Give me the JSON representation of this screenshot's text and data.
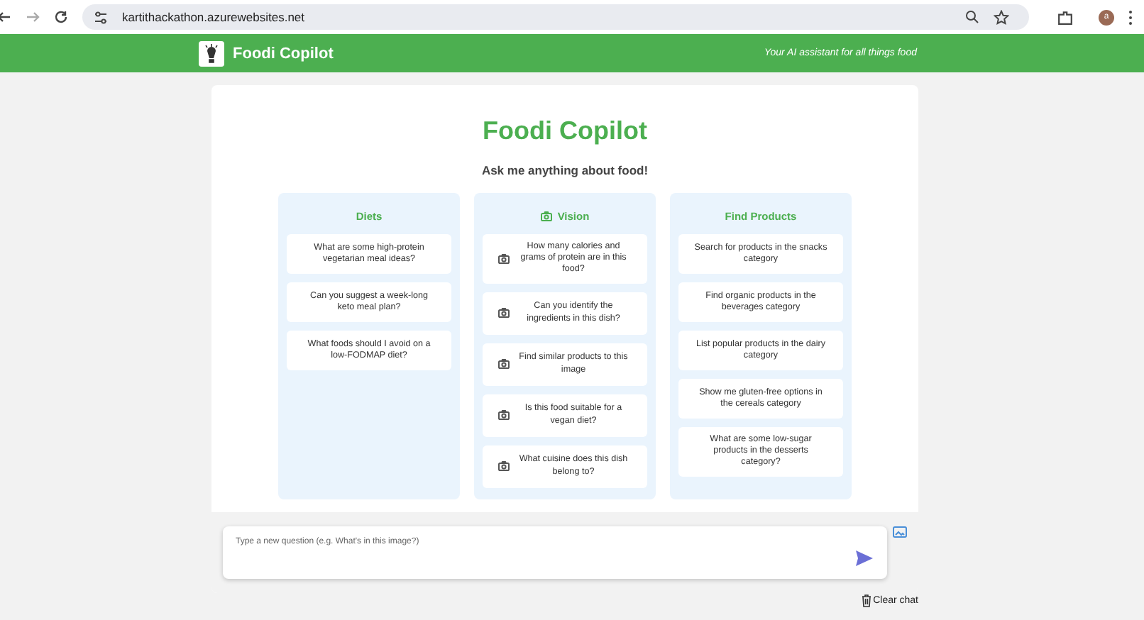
{
  "browser": {
    "url": "kartithackathon.azurewebsites.net",
    "avatar": "a"
  },
  "header": {
    "title": "Foodi Copilot",
    "tagline": "Your AI assistant for all things food"
  },
  "main": {
    "title": "Foodi Copilot",
    "subtitle": "Ask me anything about food!"
  },
  "columns": [
    {
      "title": "Diets",
      "kind": "text",
      "prompts": [
        "What are some high-protein vegetarian meal ideas?",
        "Can you suggest a week-long keto meal plan?",
        "What foods should I avoid on a low-FODMAP diet?"
      ]
    },
    {
      "title": "Vision",
      "kind": "image",
      "prompts": [
        "How many calories and grams of protein are in this food?",
        "Can you identify the ingredients in this dish?",
        "Find similar products to this image",
        "Is this food suitable for a vegan diet?",
        "What cuisine does this dish belong to?"
      ]
    },
    {
      "title": "Find Products",
      "kind": "text",
      "prompts": [
        "Search for products in the snacks category",
        "Find organic products in the beverages category",
        "List popular products in the dairy category",
        "Show me gluten-free options in the cereals category",
        "What are some low-sugar products in the desserts category?"
      ]
    }
  ],
  "chat_input": {
    "placeholder": "Type a new question (e.g. What's in this image?)"
  },
  "clear_button": "Clear chat"
}
